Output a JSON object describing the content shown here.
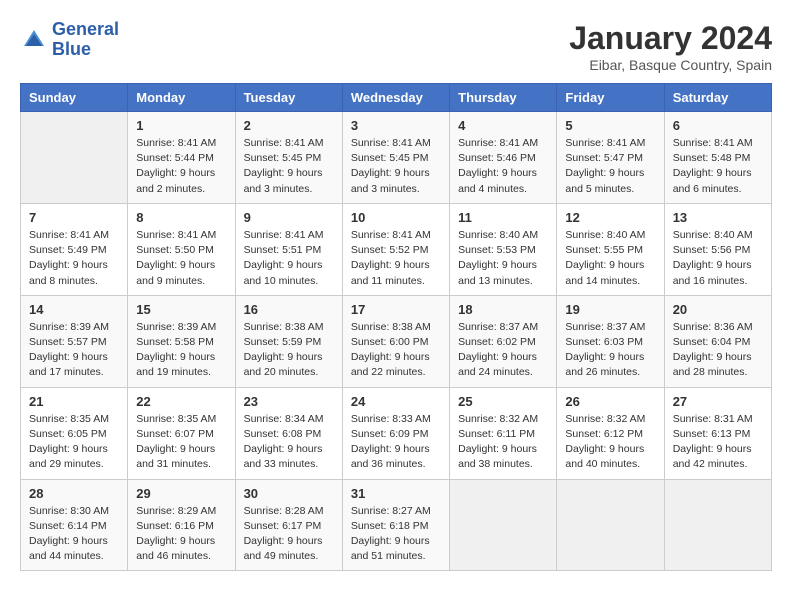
{
  "logo": {
    "line1": "General",
    "line2": "Blue"
  },
  "title": "January 2024",
  "location": "Eibar, Basque Country, Spain",
  "headers": [
    "Sunday",
    "Monday",
    "Tuesday",
    "Wednesday",
    "Thursday",
    "Friday",
    "Saturday"
  ],
  "weeks": [
    [
      {
        "day": "",
        "sunrise": "",
        "sunset": "",
        "daylight": ""
      },
      {
        "day": "1",
        "sunrise": "Sunrise: 8:41 AM",
        "sunset": "Sunset: 5:44 PM",
        "daylight": "Daylight: 9 hours and 2 minutes."
      },
      {
        "day": "2",
        "sunrise": "Sunrise: 8:41 AM",
        "sunset": "Sunset: 5:45 PM",
        "daylight": "Daylight: 9 hours and 3 minutes."
      },
      {
        "day": "3",
        "sunrise": "Sunrise: 8:41 AM",
        "sunset": "Sunset: 5:45 PM",
        "daylight": "Daylight: 9 hours and 3 minutes."
      },
      {
        "day": "4",
        "sunrise": "Sunrise: 8:41 AM",
        "sunset": "Sunset: 5:46 PM",
        "daylight": "Daylight: 9 hours and 4 minutes."
      },
      {
        "day": "5",
        "sunrise": "Sunrise: 8:41 AM",
        "sunset": "Sunset: 5:47 PM",
        "daylight": "Daylight: 9 hours and 5 minutes."
      },
      {
        "day": "6",
        "sunrise": "Sunrise: 8:41 AM",
        "sunset": "Sunset: 5:48 PM",
        "daylight": "Daylight: 9 hours and 6 minutes."
      }
    ],
    [
      {
        "day": "7",
        "sunrise": "Sunrise: 8:41 AM",
        "sunset": "Sunset: 5:49 PM",
        "daylight": "Daylight: 9 hours and 8 minutes."
      },
      {
        "day": "8",
        "sunrise": "Sunrise: 8:41 AM",
        "sunset": "Sunset: 5:50 PM",
        "daylight": "Daylight: 9 hours and 9 minutes."
      },
      {
        "day": "9",
        "sunrise": "Sunrise: 8:41 AM",
        "sunset": "Sunset: 5:51 PM",
        "daylight": "Daylight: 9 hours and 10 minutes."
      },
      {
        "day": "10",
        "sunrise": "Sunrise: 8:41 AM",
        "sunset": "Sunset: 5:52 PM",
        "daylight": "Daylight: 9 hours and 11 minutes."
      },
      {
        "day": "11",
        "sunrise": "Sunrise: 8:40 AM",
        "sunset": "Sunset: 5:53 PM",
        "daylight": "Daylight: 9 hours and 13 minutes."
      },
      {
        "day": "12",
        "sunrise": "Sunrise: 8:40 AM",
        "sunset": "Sunset: 5:55 PM",
        "daylight": "Daylight: 9 hours and 14 minutes."
      },
      {
        "day": "13",
        "sunrise": "Sunrise: 8:40 AM",
        "sunset": "Sunset: 5:56 PM",
        "daylight": "Daylight: 9 hours and 16 minutes."
      }
    ],
    [
      {
        "day": "14",
        "sunrise": "Sunrise: 8:39 AM",
        "sunset": "Sunset: 5:57 PM",
        "daylight": "Daylight: 9 hours and 17 minutes."
      },
      {
        "day": "15",
        "sunrise": "Sunrise: 8:39 AM",
        "sunset": "Sunset: 5:58 PM",
        "daylight": "Daylight: 9 hours and 19 minutes."
      },
      {
        "day": "16",
        "sunrise": "Sunrise: 8:38 AM",
        "sunset": "Sunset: 5:59 PM",
        "daylight": "Daylight: 9 hours and 20 minutes."
      },
      {
        "day": "17",
        "sunrise": "Sunrise: 8:38 AM",
        "sunset": "Sunset: 6:00 PM",
        "daylight": "Daylight: 9 hours and 22 minutes."
      },
      {
        "day": "18",
        "sunrise": "Sunrise: 8:37 AM",
        "sunset": "Sunset: 6:02 PM",
        "daylight": "Daylight: 9 hours and 24 minutes."
      },
      {
        "day": "19",
        "sunrise": "Sunrise: 8:37 AM",
        "sunset": "Sunset: 6:03 PM",
        "daylight": "Daylight: 9 hours and 26 minutes."
      },
      {
        "day": "20",
        "sunrise": "Sunrise: 8:36 AM",
        "sunset": "Sunset: 6:04 PM",
        "daylight": "Daylight: 9 hours and 28 minutes."
      }
    ],
    [
      {
        "day": "21",
        "sunrise": "Sunrise: 8:35 AM",
        "sunset": "Sunset: 6:05 PM",
        "daylight": "Daylight: 9 hours and 29 minutes."
      },
      {
        "day": "22",
        "sunrise": "Sunrise: 8:35 AM",
        "sunset": "Sunset: 6:07 PM",
        "daylight": "Daylight: 9 hours and 31 minutes."
      },
      {
        "day": "23",
        "sunrise": "Sunrise: 8:34 AM",
        "sunset": "Sunset: 6:08 PM",
        "daylight": "Daylight: 9 hours and 33 minutes."
      },
      {
        "day": "24",
        "sunrise": "Sunrise: 8:33 AM",
        "sunset": "Sunset: 6:09 PM",
        "daylight": "Daylight: 9 hours and 36 minutes."
      },
      {
        "day": "25",
        "sunrise": "Sunrise: 8:32 AM",
        "sunset": "Sunset: 6:11 PM",
        "daylight": "Daylight: 9 hours and 38 minutes."
      },
      {
        "day": "26",
        "sunrise": "Sunrise: 8:32 AM",
        "sunset": "Sunset: 6:12 PM",
        "daylight": "Daylight: 9 hours and 40 minutes."
      },
      {
        "day": "27",
        "sunrise": "Sunrise: 8:31 AM",
        "sunset": "Sunset: 6:13 PM",
        "daylight": "Daylight: 9 hours and 42 minutes."
      }
    ],
    [
      {
        "day": "28",
        "sunrise": "Sunrise: 8:30 AM",
        "sunset": "Sunset: 6:14 PM",
        "daylight": "Daylight: 9 hours and 44 minutes."
      },
      {
        "day": "29",
        "sunrise": "Sunrise: 8:29 AM",
        "sunset": "Sunset: 6:16 PM",
        "daylight": "Daylight: 9 hours and 46 minutes."
      },
      {
        "day": "30",
        "sunrise": "Sunrise: 8:28 AM",
        "sunset": "Sunset: 6:17 PM",
        "daylight": "Daylight: 9 hours and 49 minutes."
      },
      {
        "day": "31",
        "sunrise": "Sunrise: 8:27 AM",
        "sunset": "Sunset: 6:18 PM",
        "daylight": "Daylight: 9 hours and 51 minutes."
      },
      {
        "day": "",
        "sunrise": "",
        "sunset": "",
        "daylight": ""
      },
      {
        "day": "",
        "sunrise": "",
        "sunset": "",
        "daylight": ""
      },
      {
        "day": "",
        "sunrise": "",
        "sunset": "",
        "daylight": ""
      }
    ]
  ]
}
